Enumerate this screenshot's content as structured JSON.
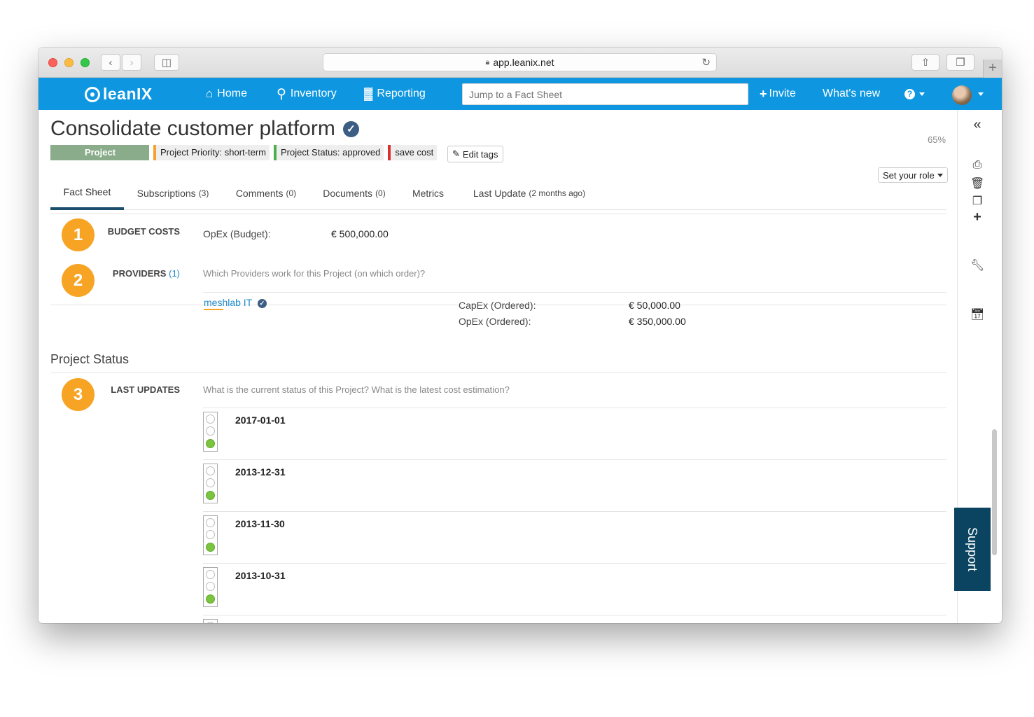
{
  "browser": {
    "url": "app.leanix.net"
  },
  "nav": {
    "logo": "leanIX",
    "home": "Home",
    "inventory": "Inventory",
    "reporting": "Reporting",
    "search_placeholder": "Jump to a Fact Sheet",
    "invite": "Invite",
    "whats_new": "What's new",
    "help_icon": "?"
  },
  "factsheet": {
    "title": "Consolidate customer platform",
    "completion": "65%",
    "tags": [
      {
        "label": "Project"
      },
      {
        "label": "Project Priority: short-term"
      },
      {
        "label": "Project Status: approved"
      },
      {
        "label": "save cost"
      }
    ],
    "edit_tags": "Edit tags",
    "set_role": "Set your role"
  },
  "tabs": [
    {
      "label": "Fact Sheet",
      "count": ""
    },
    {
      "label": "Subscriptions",
      "count": "(3)"
    },
    {
      "label": "Comments",
      "count": "(0)"
    },
    {
      "label": "Documents",
      "count": "(0)"
    },
    {
      "label": "Metrics",
      "count": ""
    },
    {
      "label": "Last Update",
      "count": "(2 months ago)"
    }
  ],
  "budget": {
    "number": "1",
    "label": "BUDGET COSTS",
    "field": "OpEx (Budget):",
    "value": "€ 500,000.00"
  },
  "providers": {
    "number": "2",
    "label": "PROVIDERS",
    "count": "(1)",
    "hint": "Which Providers work for this Project (on which order)?",
    "name": "meshlab IT",
    "capex_label": "CapEx (Ordered):",
    "capex_value": "€ 50,000.00",
    "opex_label": "OpEx (Ordered):",
    "opex_value": "€ 350,000.00"
  },
  "project_status": {
    "title": "Project Status",
    "number": "3",
    "label": "LAST UPDATES",
    "hint": "What is the current status of this Project? What is the latest cost estimation?",
    "updates": [
      {
        "date": "2017-01-01",
        "status": "green"
      },
      {
        "date": "2013-12-31",
        "status": "green"
      },
      {
        "date": "2013-11-30",
        "status": "green"
      },
      {
        "date": "2013-10-31",
        "status": "green"
      }
    ]
  },
  "sidebar": {
    "collapse_icon": "«",
    "support": "Support"
  },
  "colors": {
    "nav_blue": "#0e97e0",
    "step_orange": "#f7a424",
    "support_dark": "#0b4460"
  }
}
